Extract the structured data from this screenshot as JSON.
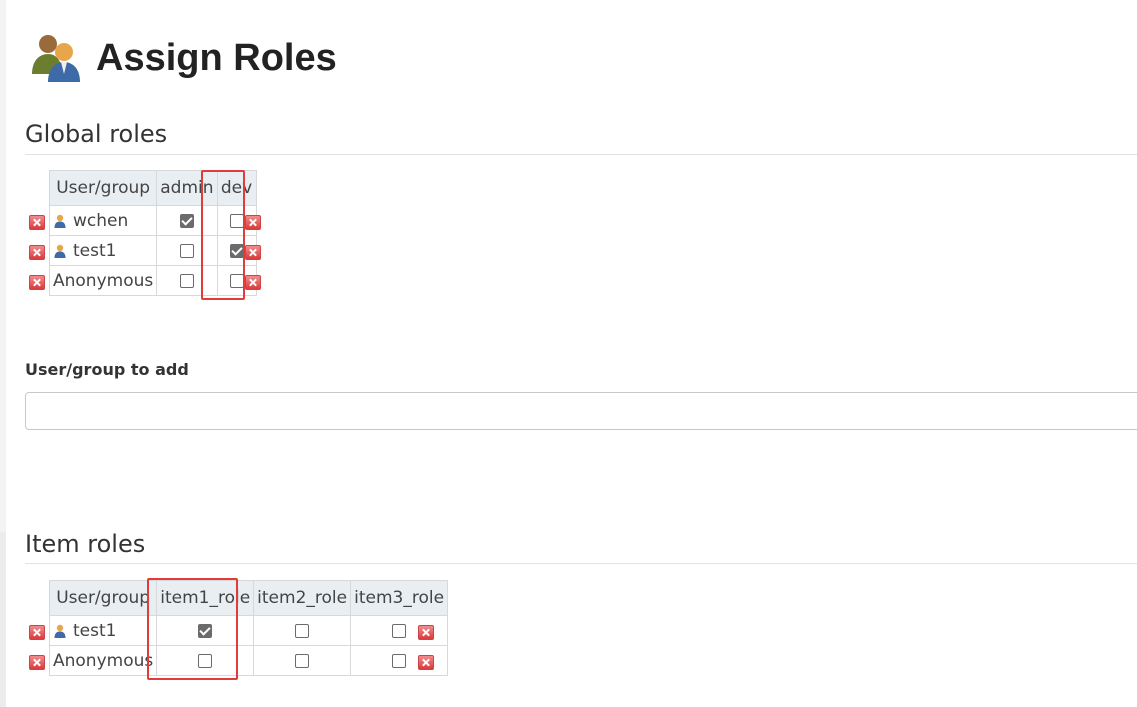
{
  "page": {
    "title": "Assign Roles",
    "icon": "users-icon"
  },
  "global_roles": {
    "title": "Global roles",
    "columns": [
      "User/group",
      "admin",
      "dev"
    ],
    "rows": [
      {
        "name": "wchen",
        "is_user": true,
        "admin": true,
        "dev": false
      },
      {
        "name": "test1",
        "is_user": true,
        "admin": false,
        "dev": true
      },
      {
        "name": "Anonymous",
        "is_user": false,
        "admin": false,
        "dev": false
      }
    ]
  },
  "add_user": {
    "label": "User/group to add",
    "value": "",
    "placeholder": ""
  },
  "item_roles": {
    "title": "Item roles",
    "columns": [
      "User/group",
      "item1_role",
      "item2_role",
      "item3_role"
    ],
    "rows": [
      {
        "name": "test1",
        "is_user": true,
        "item1_role": true,
        "item2_role": false,
        "item3_role": false
      },
      {
        "name": "Anonymous",
        "is_user": false,
        "item1_role": false,
        "item2_role": false,
        "item3_role": false
      }
    ]
  },
  "colors": {
    "highlight": "#e03c3c",
    "header_bg": "#e9eef2",
    "delete": "#d93b3b"
  }
}
